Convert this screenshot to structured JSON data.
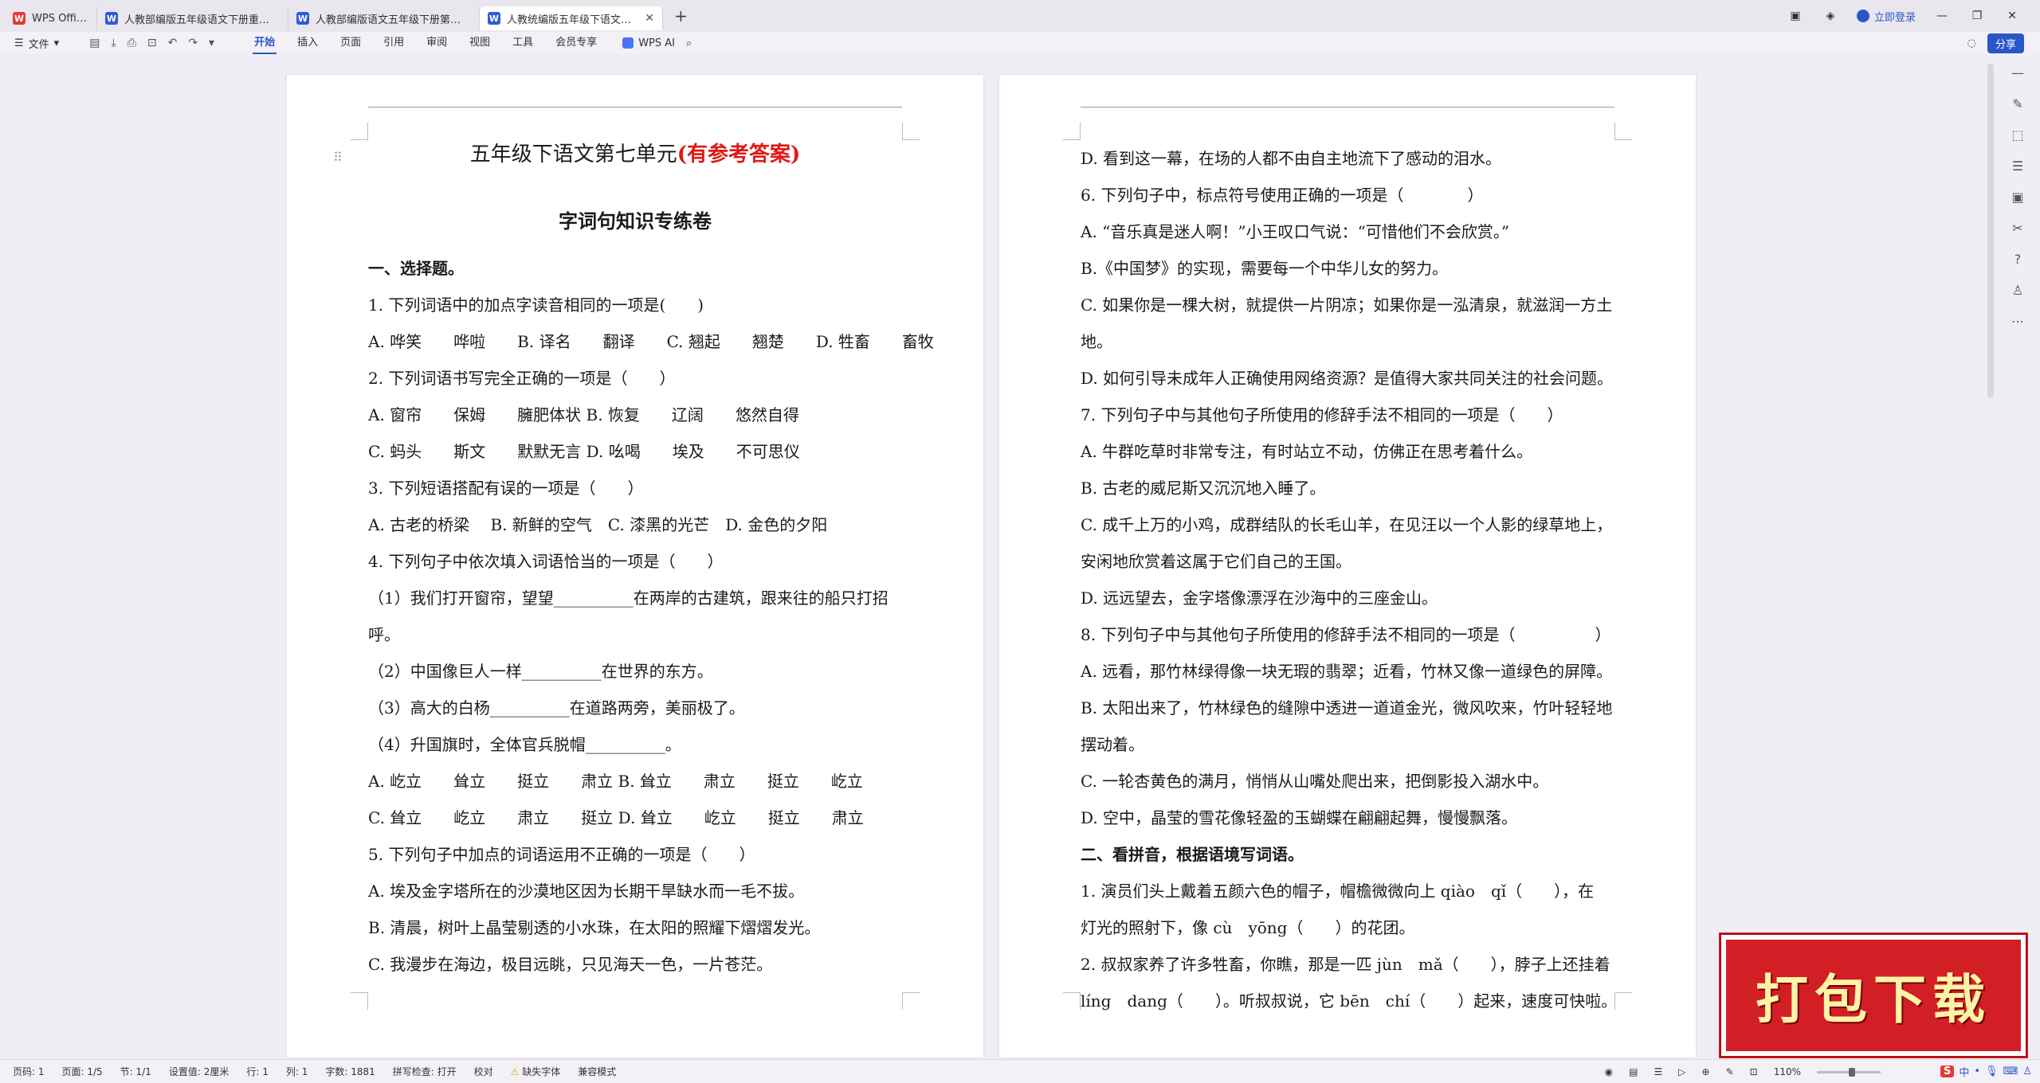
{
  "tabs": [
    {
      "label": "WPS Office"
    },
    {
      "label": "人教部编版五年级语文下册重点学校"
    },
    {
      "label": "人教部编版语文五年级下册第七单元"
    },
    {
      "label": "人教统编版五年级下语文第七"
    }
  ],
  "header_right": {
    "login": "立即登录"
  },
  "menubar": {
    "file": "文件",
    "items": [
      "开始",
      "插入",
      "页面",
      "引用",
      "审阅",
      "视图",
      "工具",
      "会员专享"
    ],
    "wps_ai": "WPS AI",
    "share": "分享"
  },
  "left_page": {
    "title_main": "五年级下语文第七单元",
    "title_red": "(有参考答案)",
    "subtitle": "字词句知识专练卷",
    "lines": [
      "一、选择题。",
      "1. 下列词语中的加点字读音相同的一项是(　　)",
      "A. 哗笑　　哗啦　　B. 译名　　翻译　　C. 翘起　　翘楚　　D. 牲畜　　畜牧",
      "2. 下列词语书写完全正确的一项是（　　）",
      "A. 窗帘　　保姆　　臃肥体状 B. 恢复　　辽阔　　悠然自得",
      "C. 蚂头　　斯文　　默默无言 D. 吆喝　　埃及　　不可思仪",
      "3. 下列短语搭配有误的一项是（　　）",
      "A. 古老的桥梁　 B. 新鲜的空气　C. 漆黑的光芒　D. 金色的夕阳",
      "4. 下列句子中依次填入词语恰当的一项是（　　）",
      "（1）我们打开窗帘，望望__________在两岸的古建筑，跟来往的船只打招",
      "呼。",
      "（2）中国像巨人一样__________在世界的东方。",
      "（3）高大的白杨__________在道路两旁，美丽极了。",
      "（4）升国旗时，全体官兵脱帽__________。",
      "A. 屹立　　耸立　　挺立　　肃立 B. 耸立　　肃立　　挺立　　屹立",
      "C. 耸立　　屹立　　肃立　　挺立 D. 耸立　　屹立　　挺立　　肃立",
      "5. 下列句子中加点的词语运用不正确的一项是（　　）",
      "A. 埃及金字塔所在的沙漠地区因为长期干旱缺水而一毛不拔。",
      "B. 清晨，树叶上晶莹剔透的小水珠，在太阳的照耀下熠熠发光。",
      "C. 我漫步在海边，极目远眺，只见海天一色，一片苍茫。"
    ]
  },
  "right_page": {
    "lines": [
      "D. 看到这一幕，在场的人都不由自主地流下了感动的泪水。",
      "6. 下列句子中，标点符号使用正确的一项是（　　　　）",
      "A. “音乐真是迷人啊！”小王叹口气说：“可惜他们不会欣赏。”",
      "B.《中国梦》的实现，需要每一个中华儿女的努力。",
      "C. 如果你是一棵大树，就提供一片阴凉；如果你是一泓清泉，就滋润一方土",
      "地。",
      "D. 如何引导未成年人正确使用网络资源？是值得大家共同关注的社会问题。",
      "7. 下列句子中与其他句子所使用的修辞手法不相同的一项是（　　）",
      "A. 牛群吃草时非常专注，有时站立不动，仿佛正在思考着什么。",
      "B. 古老的威尼斯又沉沉地入睡了。",
      "C. 成千上万的小鸡，成群结队的长毛山羊，在见汪以一个人影的绿草地上，",
      "安闲地欣赏着这属于它们自己的王国。",
      "D. 远远望去，金字塔像漂浮在沙海中的三座金山。",
      "8. 下列句子中与其他句子所使用的修辞手法不相同的一项是（　　　　　）",
      "A. 远看，那竹林绿得像一块无瑕的翡翠；近看，竹林又像一道绿色的屏障。",
      "B. 太阳出来了，竹林绿色的缝隙中透进一道道金光，微风吹来，竹叶轻轻地",
      "摆动着。",
      "C. 一轮杏黄色的满月，悄悄从山嘴处爬出来，把倒影投入湖水中。",
      "D. 空中，晶莹的雪花像轻盈的玉蝴蝶在翩翩起舞，慢慢飘落。",
      "二、看拼音，根据语境写词语。",
      "1. 演员们头上戴着五颜六色的帽子，帽檐微微向上 qiào　qǐ（　　），在",
      "灯光的照射下，像 cù　yōng（　　）的花团。",
      "2. 叔叔家养了许多牲畜，你瞧，那是一匹 jùn　mǎ（　　），脖子上还挂着",
      "líng　dang（　　）。听叔叔说，它 bēn　chí（　　）起来，速度可快啦。"
    ]
  },
  "statusbar": {
    "page_num": "页码: 1",
    "pages": "页面: 1/5",
    "section": "节: 1/1",
    "setting": "设置值: 2厘米",
    "row": "行: 1",
    "col": "列: 1",
    "words": "字数: 1881",
    "spell": "拼写检查: 打开",
    "proof": "校对",
    "missing_font": "缺失字体",
    "compat": "兼容模式",
    "zoom": "110%"
  },
  "badge": {
    "text": "打包下载"
  },
  "ime": {
    "lang": "中"
  }
}
